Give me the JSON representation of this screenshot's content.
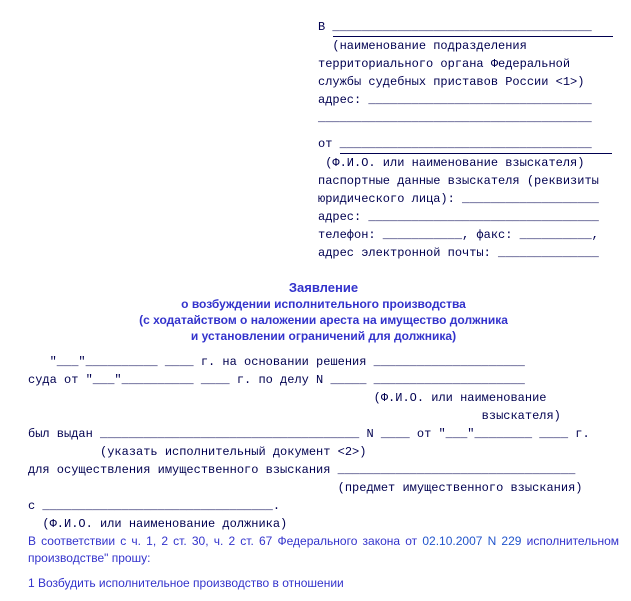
{
  "header": {
    "b_pravoe": "В ____________________________________",
    "rule_right": "________________________________________",
    "h1": "  (наименование подразделения",
    "h2": "территориального органа Федеральной",
    "h3": "службы судебных приставов России <1>)",
    "addr": "адрес: _______________________________",
    "blank": "______________________________________",
    "ot": "от ___________________________________",
    "fio_vz": " (Ф.И.О. или наименование взыскателя)",
    "pasport1": "паспортные данные взыскателя (реквизиты",
    "pasport2": "юридического лица): ___________________",
    "addr2": "адрес: ________________________________",
    "tel_fax": "телефон: ___________, факс: __________,",
    "email": "адрес электронной почты: ______________"
  },
  "title": {
    "l1": "Заявление",
    "l2": "о возбуждении исполнительного производства",
    "l3": "(с ходатайством о наложении ареста на имущество должника",
    "l4": "и установлении ограничений для должника)"
  },
  "body": {
    "l1": "   \"___\"__________ ____ г. на основании решения _____________________",
    "l2": "суда от \"___\"__________ ____ г. по делу N _____ _____________________",
    "l3": "                                                (Ф.И.О. или наименование",
    "l4": "                                                               взыскателя)",
    "l5": "был выдан ____________________________________ N ____ от \"___\"________ ____ г.",
    "l6": "          (указать исполнительный документ <2>)",
    "l7": "для осуществления имущественного взыскания _________________________________",
    "l8": "                                           (предмет имущественного взыскания)",
    "l9": "с ________________________________.",
    "l10": "  (Ф.И.О. или наименование должника)"
  },
  "para": {
    "text_a": "    В соответствии с ч. 1, 2 ст. 30, ч. 2 ст. 67 Федерального закона от ",
    "date": "02.10.2007 N 229",
    "text_b": " исполнительном производстве\" прошу:"
  },
  "footer": {
    "item1": "   1   Возбудить исполнительное производство в отношении"
  }
}
